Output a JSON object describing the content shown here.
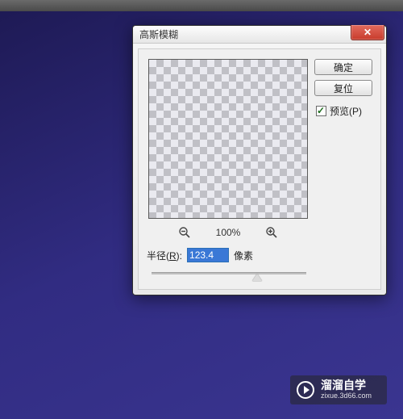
{
  "dialog": {
    "title": "高斯模糊",
    "close_glyph": "✕",
    "zoom": {
      "value": "100%"
    },
    "radius": {
      "label_prefix": "半径(",
      "hotkey": "R",
      "label_suffix": "):",
      "value": "123.4",
      "unit": "像素",
      "slider_percent": 68
    },
    "buttons": {
      "ok": "确定",
      "reset": "复位"
    },
    "preview_checkbox": {
      "checked": true,
      "label_prefix": "预览(",
      "hotkey": "P",
      "label_suffix": ")"
    }
  },
  "watermark": {
    "main": "溜溜自学",
    "sub": "zixue.3d66.com"
  }
}
